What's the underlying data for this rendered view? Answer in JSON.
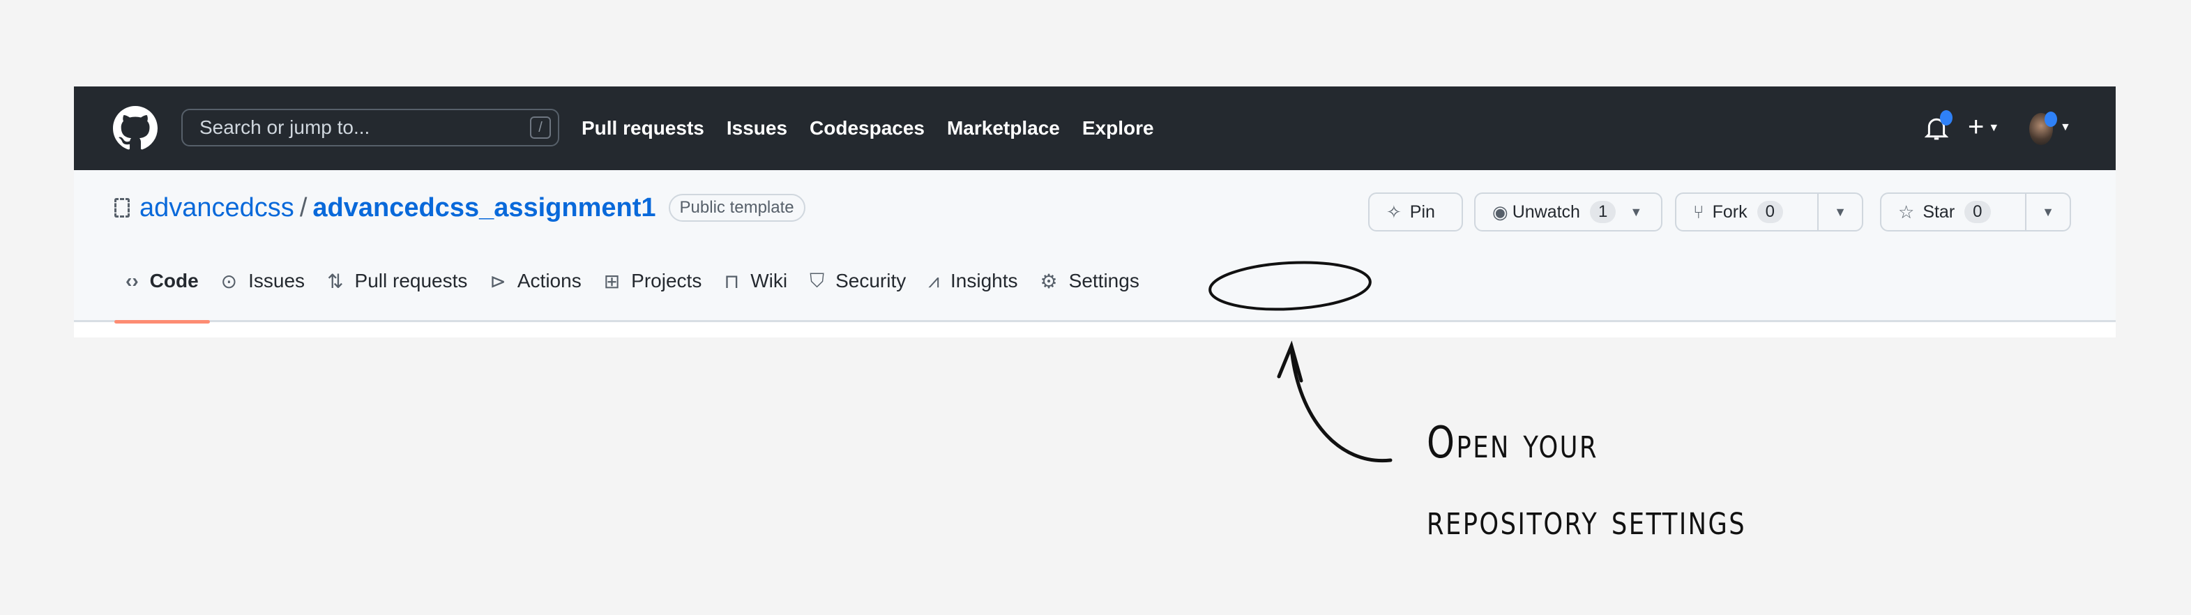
{
  "header": {
    "search_placeholder": "Search or jump to...",
    "search_shortcut": "/",
    "nav": [
      "Pull requests",
      "Issues",
      "Codespaces",
      "Marketplace",
      "Explore"
    ],
    "icons": [
      "github-logo",
      "bell-icon",
      "plus-icon",
      "avatar"
    ]
  },
  "repo": {
    "owner": "advancedcss",
    "separator": "/",
    "name": "advancedcss_assignment1",
    "badge": "Public template",
    "buttons": {
      "pin": "Pin",
      "watch": "Unwatch",
      "watch_count": "1",
      "fork": "Fork",
      "fork_count": "0",
      "star": "Star",
      "star_count": "0"
    },
    "tabs": [
      "Code",
      "Issues",
      "Pull requests",
      "Actions",
      "Projects",
      "Wiki",
      "Security",
      "Insights",
      "Settings"
    ]
  },
  "annotation": {
    "line1": "Open your",
    "line2": "repository settings"
  },
  "colors": {
    "header": "#24292f",
    "link": "#0969da",
    "tab_underline": "#fd8c73"
  }
}
